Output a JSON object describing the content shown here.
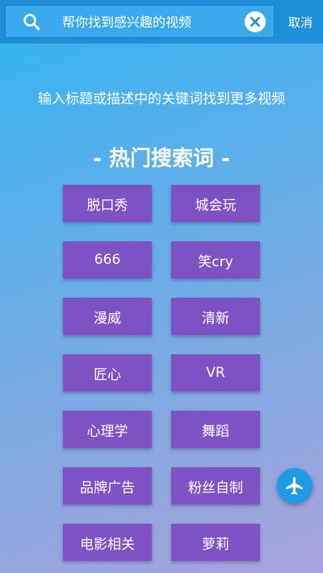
{
  "search": {
    "placeholder": "帮你找到感兴趣的视频",
    "value": "",
    "cancel_label": "取消"
  },
  "hint": "输入标题或描述中的关键词找到更多视频",
  "hot_title": "- 热门搜索词 -",
  "tags": [
    "脱口秀",
    "城会玩",
    "666",
    "笑cry",
    "漫威",
    "清新",
    "匠心",
    "VR",
    "心理学",
    "舞蹈",
    "品牌广告",
    "粉丝自制",
    "电影相关",
    "萝莉"
  ],
  "colors": {
    "topbar": "#1e8fd8",
    "tag_bg": "#7f52c4",
    "fab": "#1d9be6"
  },
  "icons": {
    "search": "search-icon",
    "clear": "close-icon",
    "fab": "airplane-icon"
  }
}
